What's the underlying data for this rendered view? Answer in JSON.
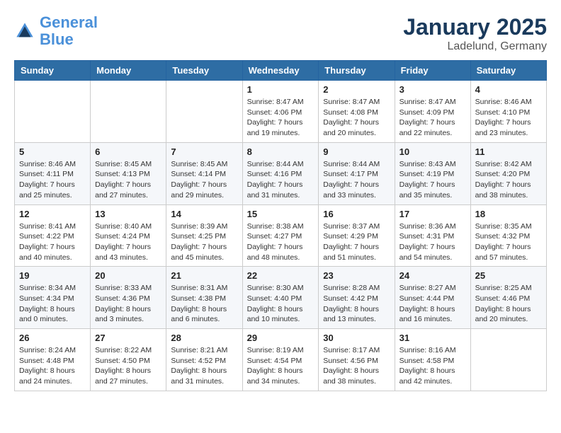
{
  "logo": {
    "line1": "General",
    "line2": "Blue"
  },
  "title": "January 2025",
  "location": "Ladelund, Germany",
  "days_of_week": [
    "Sunday",
    "Monday",
    "Tuesday",
    "Wednesday",
    "Thursday",
    "Friday",
    "Saturday"
  ],
  "weeks": [
    [
      {
        "day": "",
        "info": ""
      },
      {
        "day": "",
        "info": ""
      },
      {
        "day": "",
        "info": ""
      },
      {
        "day": "1",
        "info": "Sunrise: 8:47 AM\nSunset: 4:06 PM\nDaylight: 7 hours\nand 19 minutes."
      },
      {
        "day": "2",
        "info": "Sunrise: 8:47 AM\nSunset: 4:08 PM\nDaylight: 7 hours\nand 20 minutes."
      },
      {
        "day": "3",
        "info": "Sunrise: 8:47 AM\nSunset: 4:09 PM\nDaylight: 7 hours\nand 22 minutes."
      },
      {
        "day": "4",
        "info": "Sunrise: 8:46 AM\nSunset: 4:10 PM\nDaylight: 7 hours\nand 23 minutes."
      }
    ],
    [
      {
        "day": "5",
        "info": "Sunrise: 8:46 AM\nSunset: 4:11 PM\nDaylight: 7 hours\nand 25 minutes."
      },
      {
        "day": "6",
        "info": "Sunrise: 8:45 AM\nSunset: 4:13 PM\nDaylight: 7 hours\nand 27 minutes."
      },
      {
        "day": "7",
        "info": "Sunrise: 8:45 AM\nSunset: 4:14 PM\nDaylight: 7 hours\nand 29 minutes."
      },
      {
        "day": "8",
        "info": "Sunrise: 8:44 AM\nSunset: 4:16 PM\nDaylight: 7 hours\nand 31 minutes."
      },
      {
        "day": "9",
        "info": "Sunrise: 8:44 AM\nSunset: 4:17 PM\nDaylight: 7 hours\nand 33 minutes."
      },
      {
        "day": "10",
        "info": "Sunrise: 8:43 AM\nSunset: 4:19 PM\nDaylight: 7 hours\nand 35 minutes."
      },
      {
        "day": "11",
        "info": "Sunrise: 8:42 AM\nSunset: 4:20 PM\nDaylight: 7 hours\nand 38 minutes."
      }
    ],
    [
      {
        "day": "12",
        "info": "Sunrise: 8:41 AM\nSunset: 4:22 PM\nDaylight: 7 hours\nand 40 minutes."
      },
      {
        "day": "13",
        "info": "Sunrise: 8:40 AM\nSunset: 4:24 PM\nDaylight: 7 hours\nand 43 minutes."
      },
      {
        "day": "14",
        "info": "Sunrise: 8:39 AM\nSunset: 4:25 PM\nDaylight: 7 hours\nand 45 minutes."
      },
      {
        "day": "15",
        "info": "Sunrise: 8:38 AM\nSunset: 4:27 PM\nDaylight: 7 hours\nand 48 minutes."
      },
      {
        "day": "16",
        "info": "Sunrise: 8:37 AM\nSunset: 4:29 PM\nDaylight: 7 hours\nand 51 minutes."
      },
      {
        "day": "17",
        "info": "Sunrise: 8:36 AM\nSunset: 4:31 PM\nDaylight: 7 hours\nand 54 minutes."
      },
      {
        "day": "18",
        "info": "Sunrise: 8:35 AM\nSunset: 4:32 PM\nDaylight: 7 hours\nand 57 minutes."
      }
    ],
    [
      {
        "day": "19",
        "info": "Sunrise: 8:34 AM\nSunset: 4:34 PM\nDaylight: 8 hours\nand 0 minutes."
      },
      {
        "day": "20",
        "info": "Sunrise: 8:33 AM\nSunset: 4:36 PM\nDaylight: 8 hours\nand 3 minutes."
      },
      {
        "day": "21",
        "info": "Sunrise: 8:31 AM\nSunset: 4:38 PM\nDaylight: 8 hours\nand 6 minutes."
      },
      {
        "day": "22",
        "info": "Sunrise: 8:30 AM\nSunset: 4:40 PM\nDaylight: 8 hours\nand 10 minutes."
      },
      {
        "day": "23",
        "info": "Sunrise: 8:28 AM\nSunset: 4:42 PM\nDaylight: 8 hours\nand 13 minutes."
      },
      {
        "day": "24",
        "info": "Sunrise: 8:27 AM\nSunset: 4:44 PM\nDaylight: 8 hours\nand 16 minutes."
      },
      {
        "day": "25",
        "info": "Sunrise: 8:25 AM\nSunset: 4:46 PM\nDaylight: 8 hours\nand 20 minutes."
      }
    ],
    [
      {
        "day": "26",
        "info": "Sunrise: 8:24 AM\nSunset: 4:48 PM\nDaylight: 8 hours\nand 24 minutes."
      },
      {
        "day": "27",
        "info": "Sunrise: 8:22 AM\nSunset: 4:50 PM\nDaylight: 8 hours\nand 27 minutes."
      },
      {
        "day": "28",
        "info": "Sunrise: 8:21 AM\nSunset: 4:52 PM\nDaylight: 8 hours\nand 31 minutes."
      },
      {
        "day": "29",
        "info": "Sunrise: 8:19 AM\nSunset: 4:54 PM\nDaylight: 8 hours\nand 34 minutes."
      },
      {
        "day": "30",
        "info": "Sunrise: 8:17 AM\nSunset: 4:56 PM\nDaylight: 8 hours\nand 38 minutes."
      },
      {
        "day": "31",
        "info": "Sunrise: 8:16 AM\nSunset: 4:58 PM\nDaylight: 8 hours\nand 42 minutes."
      },
      {
        "day": "",
        "info": ""
      }
    ]
  ]
}
